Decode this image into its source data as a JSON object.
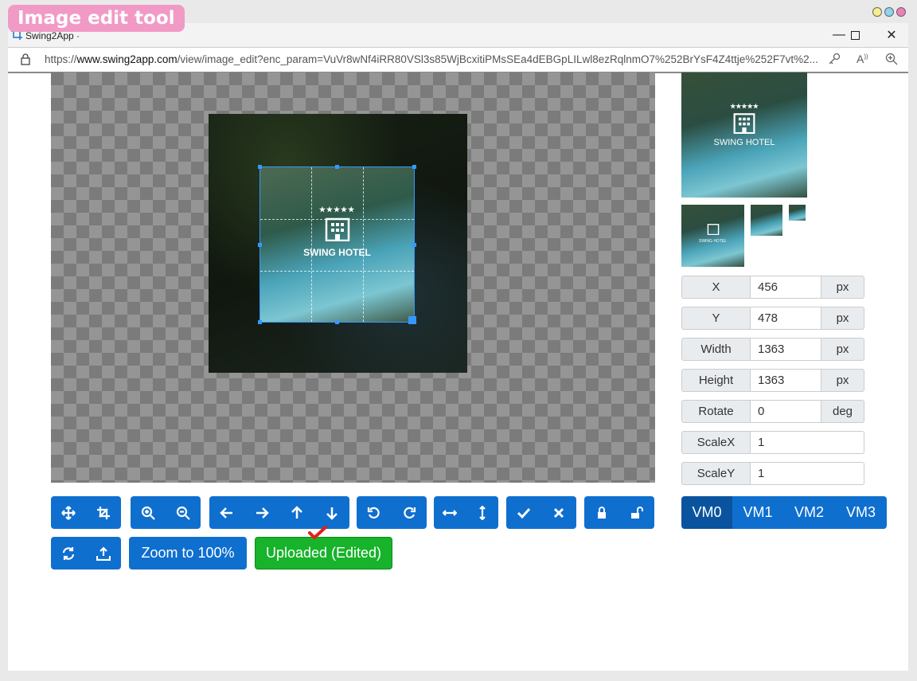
{
  "badge": "Image edit tool",
  "browser": {
    "tab_title": "Swing2App ·",
    "url_prefix": "https://",
    "url_host": "www.swing2app.com",
    "url_path": "/view/image_edit?enc_param=VuVr8wNf4iRR80VSl3s85WjBcxitiPMsSEa4dEBGpLILwl8ezRqlnmO7%252BrYsF4Z4ttje%252F7vt%2..."
  },
  "image": {
    "logo_text": "SWING HOTEL",
    "stars": "★★★★★"
  },
  "fields": [
    {
      "label": "X",
      "value": "456",
      "unit": "px"
    },
    {
      "label": "Y",
      "value": "478",
      "unit": "px"
    },
    {
      "label": "Width",
      "value": "1363",
      "unit": "px"
    },
    {
      "label": "Height",
      "value": "1363",
      "unit": "px"
    },
    {
      "label": "Rotate",
      "value": "0",
      "unit": "deg"
    },
    {
      "label": "ScaleX",
      "value": "1"
    },
    {
      "label": "ScaleY",
      "value": "1"
    }
  ],
  "view_modes": [
    "VM0",
    "VM1",
    "VM2",
    "VM3"
  ],
  "buttons": {
    "zoom_100": "Zoom to 100%",
    "uploaded": "Uploaded (Edited)"
  },
  "colors": {
    "primary": "#0f6fcf",
    "success": "#17b32a",
    "badge": "#f19ac6",
    "crop": "#3399ff"
  }
}
